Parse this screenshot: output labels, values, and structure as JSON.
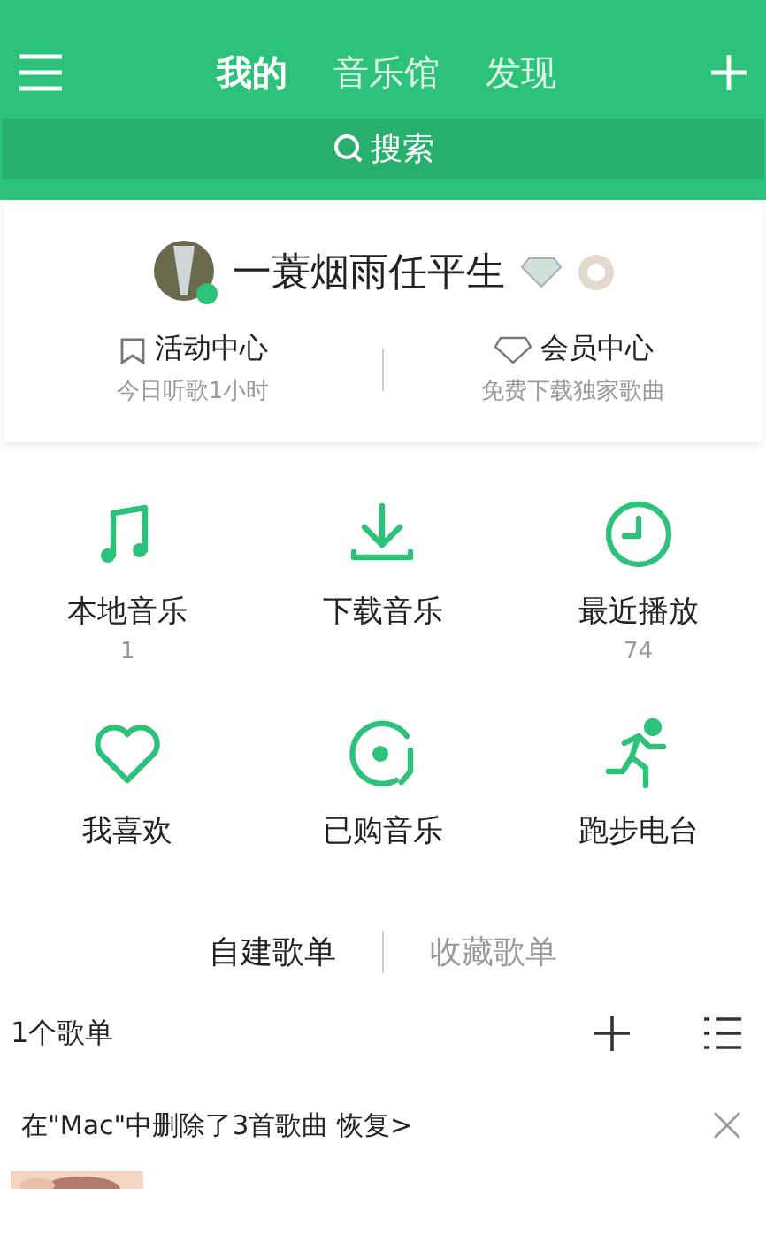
{
  "nav": {
    "tabs": [
      {
        "label": "我的",
        "selected": true
      },
      {
        "label": "音乐馆",
        "selected": false
      },
      {
        "label": "发现",
        "selected": false
      }
    ]
  },
  "search": {
    "label": "搜索"
  },
  "profile": {
    "name": "一蓑烟雨任平生",
    "links": [
      {
        "kind": "activity",
        "title": "活动中心",
        "subtitle": "今日听歌1小时"
      },
      {
        "kind": "vip",
        "title": "会员中心",
        "subtitle": "免费下载独家歌曲"
      }
    ]
  },
  "shortcuts": [
    {
      "kind": "note",
      "label": "本地音乐",
      "count": "1"
    },
    {
      "kind": "download",
      "label": "下载音乐"
    },
    {
      "kind": "clock",
      "label": "最近播放",
      "count": "74"
    },
    {
      "kind": "heart",
      "label": "我喜欢"
    },
    {
      "kind": "disc",
      "label": "已购音乐"
    },
    {
      "kind": "runner",
      "label": "跑步电台"
    }
  ],
  "playlist_tabs": [
    {
      "label": "自建歌单",
      "selected": true
    },
    {
      "label": "收藏歌单",
      "selected": false
    }
  ],
  "playlist_count": "1个歌单",
  "notice": {
    "text": "在\"Mac\"中删除了3首歌曲",
    "link": "恢复>"
  }
}
